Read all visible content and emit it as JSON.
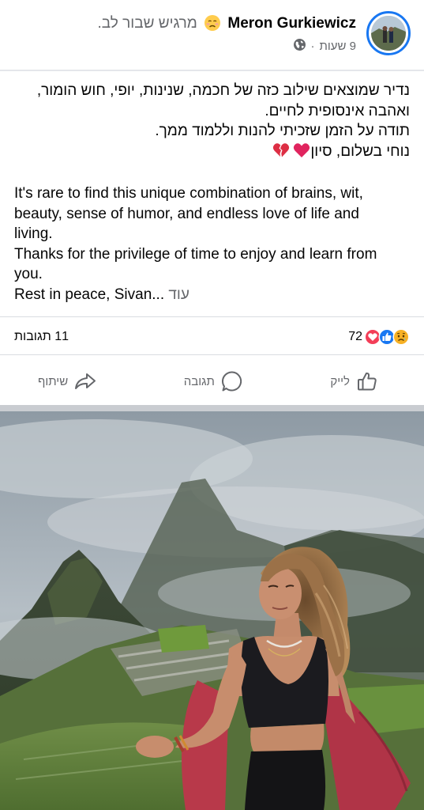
{
  "post": {
    "author": {
      "name": "Meron Gurkiewicz",
      "feeling_text": "מרגיש שבור לב.",
      "feeling_emoji": "sad-face-icon"
    },
    "time_ago": "9 שעות",
    "audience_icon": "globe-icon",
    "separator": "·",
    "text": {
      "hebrew_lines": [
        "נדיר שמוצאים שילוב כזה של חכמה, שנינות, יופי, חוש הומור,",
        "ואהבה אינסופית לחיים.",
        "תודה על הזמן שזכיתי להנות וללמוד ממך.",
        "נוחי בשלום, סיון"
      ],
      "english_lines": [
        "It's rare to find this unique combination of brains, wit,",
        "beauty, sense of humor, and endless love of life and",
        "living.",
        "Thanks for the privilege of time to enjoy and learn from",
        "you.",
        "Rest in peace, Sivan..."
      ],
      "see_more": "עוד"
    },
    "stats": {
      "reactions_count": "72",
      "reaction_icons": [
        "sad-reaction-icon",
        "like-reaction-icon",
        "love-reaction-icon"
      ],
      "comments": "11 תגובות"
    },
    "actions": {
      "like": "לייק",
      "comment": "תגובה",
      "share": "שיתוף"
    }
  },
  "colors": {
    "facebook_blue": "#1877f2",
    "secondary_text": "#65676b",
    "divider": "#dadde1",
    "love_red": "#f33e58",
    "sad_yellow": "#f7b125"
  }
}
